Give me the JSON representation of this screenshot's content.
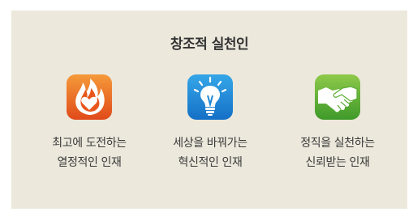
{
  "title": "창조적 실천인",
  "items": [
    {
      "icon": "flame-heart-icon",
      "color": "#e8631f",
      "line1": "최고에 도전하는",
      "line2": "열정적인 인재"
    },
    {
      "icon": "lightbulb-icon",
      "color": "#1e88d6",
      "line1": "세상을 바꿔가는",
      "line2": "혁신적인 인재"
    },
    {
      "icon": "handshake-icon",
      "color": "#5aae34",
      "line1": "정직을 실천하는",
      "line2": "신뢰받는 인재"
    }
  ]
}
